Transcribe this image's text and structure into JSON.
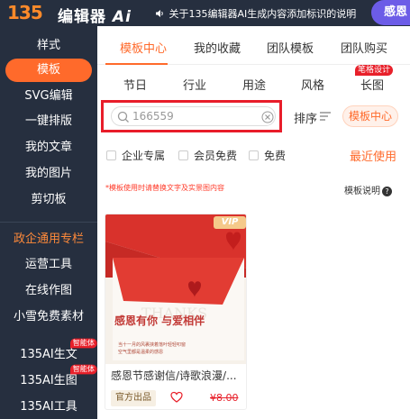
{
  "header": {
    "logo_number": "135",
    "logo_text": "编辑器",
    "logo_ai": "Ai",
    "notice": "关于135编辑器AI生成内容添加标识的说明",
    "right_button": "感恩"
  },
  "sidebar": {
    "items": [
      {
        "label": "样式"
      },
      {
        "label": "模板",
        "active": true
      },
      {
        "label": "SVG编辑"
      },
      {
        "label": "一键排版"
      },
      {
        "label": "我的文章"
      },
      {
        "label": "我的图片"
      },
      {
        "label": "剪切板"
      },
      {
        "label": "政企通用专栏",
        "highlight": true
      },
      {
        "label": "运营工具"
      },
      {
        "label": "在线作图"
      },
      {
        "label": "小雪免费素材"
      },
      {
        "label": "135AI生文",
        "badge": "智能体"
      },
      {
        "label": "135AI生图",
        "badge": "智能体"
      },
      {
        "label": "135AI工具"
      }
    ]
  },
  "tabs": [
    {
      "label": "模板中心",
      "active": true
    },
    {
      "label": "我的收藏"
    },
    {
      "label": "团队模板"
    },
    {
      "label": "团队购买"
    }
  ],
  "categories": [
    {
      "label": "节日"
    },
    {
      "label": "行业"
    },
    {
      "label": "用途"
    },
    {
      "label": "风格"
    },
    {
      "label": "长图",
      "badge": "笔格设计"
    }
  ],
  "search": {
    "value": "166559",
    "placeholder": "166559"
  },
  "sort_label": "排序",
  "template_center_button": "模板中心",
  "filters": [
    {
      "label": "企业专属",
      "checked": false
    },
    {
      "label": "会员免费",
      "checked": false
    },
    {
      "label": "免费",
      "checked": false
    }
  ],
  "recent_link": "最近使用",
  "hint": "*模板使用时请替换文字及实景图内容",
  "template_help": "模板说明",
  "help_glyph": "?",
  "card": {
    "vip_label": "VIP",
    "image_headline": "感恩有你 与爱相伴",
    "image_subline_1": "当十一月的风裹挟着落叶轻轻叩窗",
    "image_subline_2": "空气里都是温柔的感恩",
    "image_watermark": "THANKS",
    "title": "感恩节感谢信/诗歌浪漫/...",
    "tag": "官方出品",
    "price": "¥8.00"
  },
  "colors": {
    "sidebar_bg": "#262f3f",
    "accent": "#ff6a2b",
    "highlight_frame": "#e81d2a",
    "badge_red": "#e8202a",
    "purple_button": "#6c5ce7"
  }
}
